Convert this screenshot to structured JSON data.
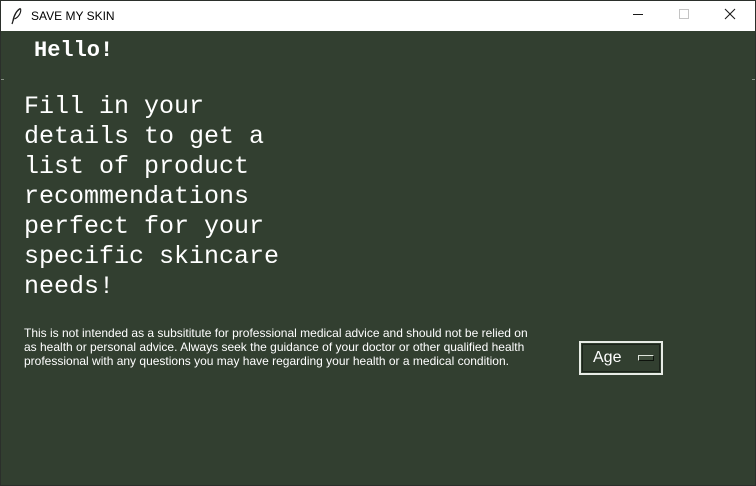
{
  "window": {
    "title": "SAVE MY SKIN",
    "icon": "feather-icon",
    "controls": [
      "minimize-icon",
      "maximize-icon",
      "close-icon"
    ]
  },
  "main": {
    "greeting": "Hello!",
    "intro": "Fill in your\ndetails to get a\nlist of product\nrecommendations\nperfect for your\nspecific skincare\nneeds!",
    "disclaimer": "This is not intended as a subsititute for professional medical advice and should not be relied on as health or personal advice. Always seek the guidance of your doctor or other qualified health professional with any questions you may have regarding your health or a medical condition."
  },
  "age_menu": {
    "selected": "Age"
  },
  "colors": {
    "background": "#323f30",
    "text": "#ffffff",
    "titlebar": "#ffffff"
  }
}
